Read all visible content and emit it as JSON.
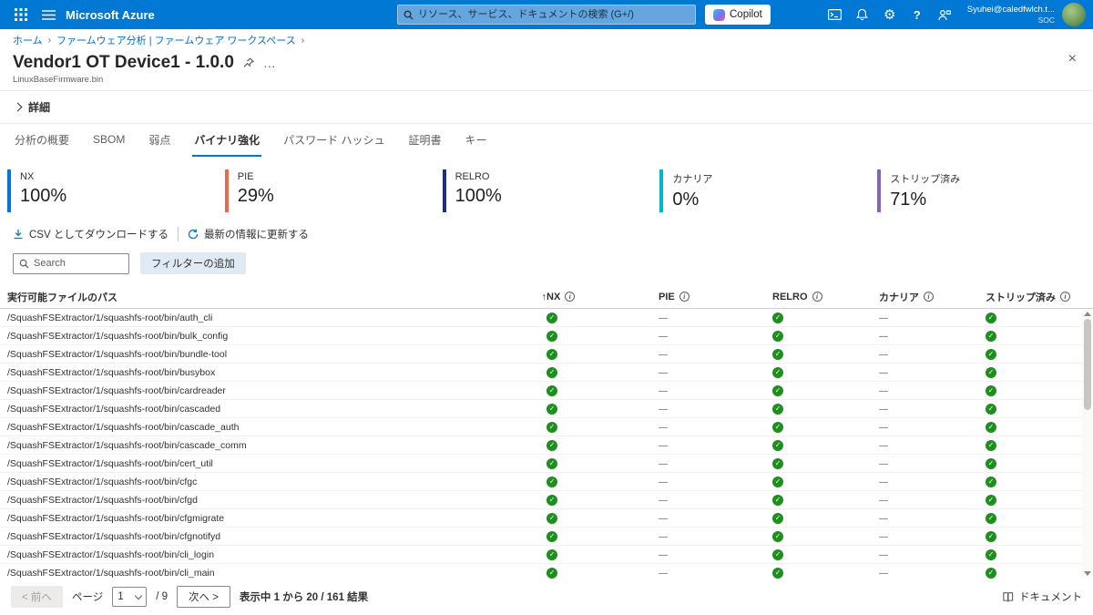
{
  "colors": {
    "accent": "#0078d4",
    "pass": "#1e8e1e",
    "na_dash": "#605e5c"
  },
  "icons": {
    "sort_ascending": "↑",
    "close": "×",
    "more": "…",
    "gear": "⚙",
    "help": "?",
    "check": "✓",
    "dash": "—",
    "breadcrumb_sep": "›"
  },
  "topbar": {
    "brand": "Microsoft Azure",
    "search_placeholder": "リソース、サービス、ドキュメントの検索 (G+/)",
    "copilot_label": "Copilot",
    "user_name": "Syuhei@caledfwlch.t...",
    "user_org": "SOC"
  },
  "breadcrumb": {
    "items": [
      {
        "label": "ホーム"
      },
      {
        "label": "ファームウェア分析 | ファームウェア ワークスペース"
      }
    ]
  },
  "header": {
    "title": "Vendor1 OT Device1 - 1.0.0",
    "subtitle": "LinuxBaseFirmware.bin"
  },
  "details": {
    "label": "詳細"
  },
  "tabs": [
    {
      "label": "分析の概要"
    },
    {
      "label": "SBOM"
    },
    {
      "label": "弱点"
    },
    {
      "label": "バイナリ強化"
    },
    {
      "label": "パスワード ハッシュ"
    },
    {
      "label": "証明書"
    },
    {
      "label": "キー"
    }
  ],
  "metrics": [
    {
      "label": "NX",
      "value": "100%",
      "color": "#0078d4"
    },
    {
      "label": "PIE",
      "value": "29%",
      "color": "#e8694f"
    },
    {
      "label": "RELRO",
      "value": "100%",
      "color": "#1f2f7a"
    },
    {
      "label": "カナリア",
      "value": "0%",
      "color": "#00b7c3"
    },
    {
      "label": "ストリップ済み",
      "value": "71%",
      "color": "#8764b8"
    }
  ],
  "toolbar": {
    "download_label": "CSV としてダウンロードする",
    "refresh_label": "最新の情報に更新する"
  },
  "filters": {
    "search_placeholder": "Search",
    "add_filter_label": "フィルターの追加"
  },
  "table": {
    "path_header": "実行可能ファイルのパス",
    "columns": [
      "NX",
      "PIE",
      "RELRO",
      "カナリア",
      "ストリップ済み"
    ],
    "rows": [
      {
        "path": "/SquashFSExtractor/1/squashfs-root/bin/auth_cli",
        "statuses": [
          "pass",
          "na",
          "pass",
          "na",
          "pass"
        ]
      },
      {
        "path": "/SquashFSExtractor/1/squashfs-root/bin/bulk_config",
        "statuses": [
          "pass",
          "na",
          "pass",
          "na",
          "pass"
        ]
      },
      {
        "path": "/SquashFSExtractor/1/squashfs-root/bin/bundle-tool",
        "statuses": [
          "pass",
          "na",
          "pass",
          "na",
          "pass"
        ]
      },
      {
        "path": "/SquashFSExtractor/1/squashfs-root/bin/busybox",
        "statuses": [
          "pass",
          "na",
          "pass",
          "na",
          "pass"
        ]
      },
      {
        "path": "/SquashFSExtractor/1/squashfs-root/bin/cardreader",
        "statuses": [
          "pass",
          "na",
          "pass",
          "na",
          "pass"
        ]
      },
      {
        "path": "/SquashFSExtractor/1/squashfs-root/bin/cascaded",
        "statuses": [
          "pass",
          "na",
          "pass",
          "na",
          "pass"
        ]
      },
      {
        "path": "/SquashFSExtractor/1/squashfs-root/bin/cascade_auth",
        "statuses": [
          "pass",
          "na",
          "pass",
          "na",
          "pass"
        ]
      },
      {
        "path": "/SquashFSExtractor/1/squashfs-root/bin/cascade_comm",
        "statuses": [
          "pass",
          "na",
          "pass",
          "na",
          "pass"
        ]
      },
      {
        "path": "/SquashFSExtractor/1/squashfs-root/bin/cert_util",
        "statuses": [
          "pass",
          "na",
          "pass",
          "na",
          "pass"
        ]
      },
      {
        "path": "/SquashFSExtractor/1/squashfs-root/bin/cfgc",
        "statuses": [
          "pass",
          "na",
          "pass",
          "na",
          "pass"
        ]
      },
      {
        "path": "/SquashFSExtractor/1/squashfs-root/bin/cfgd",
        "statuses": [
          "pass",
          "na",
          "pass",
          "na",
          "pass"
        ]
      },
      {
        "path": "/SquashFSExtractor/1/squashfs-root/bin/cfgmigrate",
        "statuses": [
          "pass",
          "na",
          "pass",
          "na",
          "pass"
        ]
      },
      {
        "path": "/SquashFSExtractor/1/squashfs-root/bin/cfgnotifyd",
        "statuses": [
          "pass",
          "na",
          "pass",
          "na",
          "pass"
        ]
      },
      {
        "path": "/SquashFSExtractor/1/squashfs-root/bin/cli_login",
        "statuses": [
          "pass",
          "na",
          "pass",
          "na",
          "pass"
        ]
      },
      {
        "path": "/SquashFSExtractor/1/squashfs-root/bin/cli_main",
        "statuses": [
          "pass",
          "na",
          "pass",
          "na",
          "pass"
        ]
      }
    ]
  },
  "pagination": {
    "prev_label": "< 前へ",
    "page_label": "ページ",
    "current_page": "1",
    "total_pages": "/ 9",
    "next_label": "次へ >",
    "summary": "表示中 1 から 20 / 161 結果",
    "docs_label": "ドキュメント"
  }
}
